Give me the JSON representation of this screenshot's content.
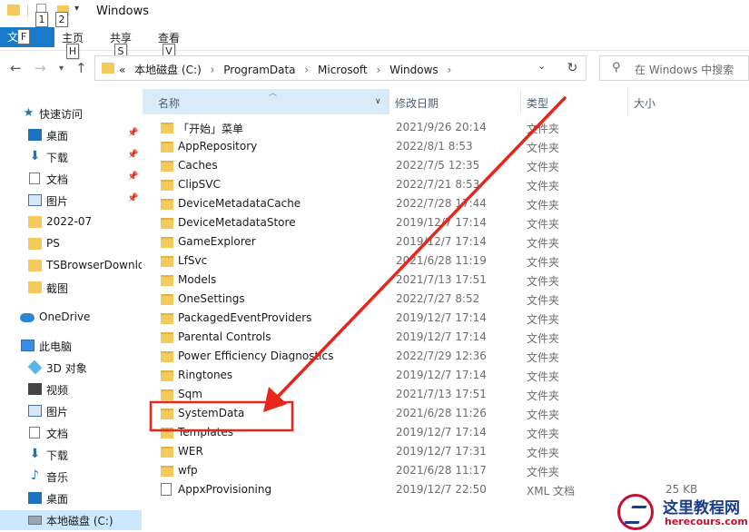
{
  "window": {
    "title": "Windows"
  },
  "keytips": {
    "qa1": "1",
    "qa2": "2",
    "file": "F",
    "home": "H",
    "share": "S",
    "view": "V"
  },
  "ribbon": {
    "file": "文件",
    "tabs": [
      "主页",
      "共享",
      "查看"
    ]
  },
  "address": {
    "overflow": "«",
    "crumbs": [
      "本地磁盘 (C:)",
      "ProgramData",
      "Microsoft",
      "Windows"
    ],
    "separator": "›"
  },
  "search": {
    "placeholder": "在 Windows 中搜索"
  },
  "nav": {
    "quick_access": "快速访问",
    "pinned": [
      "桌面",
      "下载",
      "文档",
      "图片"
    ],
    "recent": [
      "2022-07",
      "PS",
      "TSBrowserDownloads",
      "截图"
    ],
    "onedrive": "OneDrive",
    "this_pc": "此电脑",
    "pc_items": [
      "3D 对象",
      "视频",
      "图片",
      "文档",
      "下载",
      "音乐",
      "桌面"
    ],
    "drive": "本地磁盘 (C:)"
  },
  "columns": {
    "name": "名称",
    "date": "修改日期",
    "type": "类型",
    "size": "大小"
  },
  "files": [
    {
      "name": "「开始」菜单",
      "date": "2021/9/26 20:14",
      "type": "文件夹",
      "size": ""
    },
    {
      "name": "AppRepository",
      "date": "2022/8/1 8:53",
      "type": "文件夹",
      "size": ""
    },
    {
      "name": "Caches",
      "date": "2022/7/5 12:35",
      "type": "文件夹",
      "size": ""
    },
    {
      "name": "ClipSVC",
      "date": "2022/7/21 8:53",
      "type": "文件夹",
      "size": ""
    },
    {
      "name": "DeviceMetadataCache",
      "date": "2022/7/28 17:44",
      "type": "文件夹",
      "size": ""
    },
    {
      "name": "DeviceMetadataStore",
      "date": "2019/12/7 17:14",
      "type": "文件夹",
      "size": ""
    },
    {
      "name": "GameExplorer",
      "date": "2019/12/7 17:14",
      "type": "文件夹",
      "size": ""
    },
    {
      "name": "LfSvc",
      "date": "2021/6/28 11:19",
      "type": "文件夹",
      "size": ""
    },
    {
      "name": "Models",
      "date": "2021/7/13 17:51",
      "type": "文件夹",
      "size": ""
    },
    {
      "name": "OneSettings",
      "date": "2022/7/27 8:52",
      "type": "文件夹",
      "size": ""
    },
    {
      "name": "PackagedEventProviders",
      "date": "2019/12/7 17:14",
      "type": "文件夹",
      "size": ""
    },
    {
      "name": "Parental Controls",
      "date": "2019/12/7 17:14",
      "type": "文件夹",
      "size": ""
    },
    {
      "name": "Power Efficiency Diagnostics",
      "date": "2022/7/29 12:36",
      "type": "文件夹",
      "size": ""
    },
    {
      "name": "Ringtones",
      "date": "2019/12/7 17:14",
      "type": "文件夹",
      "size": ""
    },
    {
      "name": "Sqm",
      "date": "2021/7/13 17:51",
      "type": "文件夹",
      "size": ""
    },
    {
      "name": "SystemData",
      "date": "2021/6/28 11:26",
      "type": "文件夹",
      "size": ""
    },
    {
      "name": "Templates",
      "date": "2019/12/7 17:14",
      "type": "文件夹",
      "size": ""
    },
    {
      "name": "WER",
      "date": "2019/12/7 17:31",
      "type": "文件夹",
      "size": ""
    },
    {
      "name": "wfp",
      "date": "2021/6/28 11:17",
      "type": "文件夹",
      "size": ""
    },
    {
      "name": "AppxProvisioning",
      "date": "2019/12/7 22:50",
      "type": "XML 文档",
      "size": "25 KB"
    }
  ],
  "highlight": {
    "target": "SystemData",
    "color": "#e8251b"
  },
  "watermark": {
    "title": "这里教程网",
    "url": "herecours.com"
  }
}
